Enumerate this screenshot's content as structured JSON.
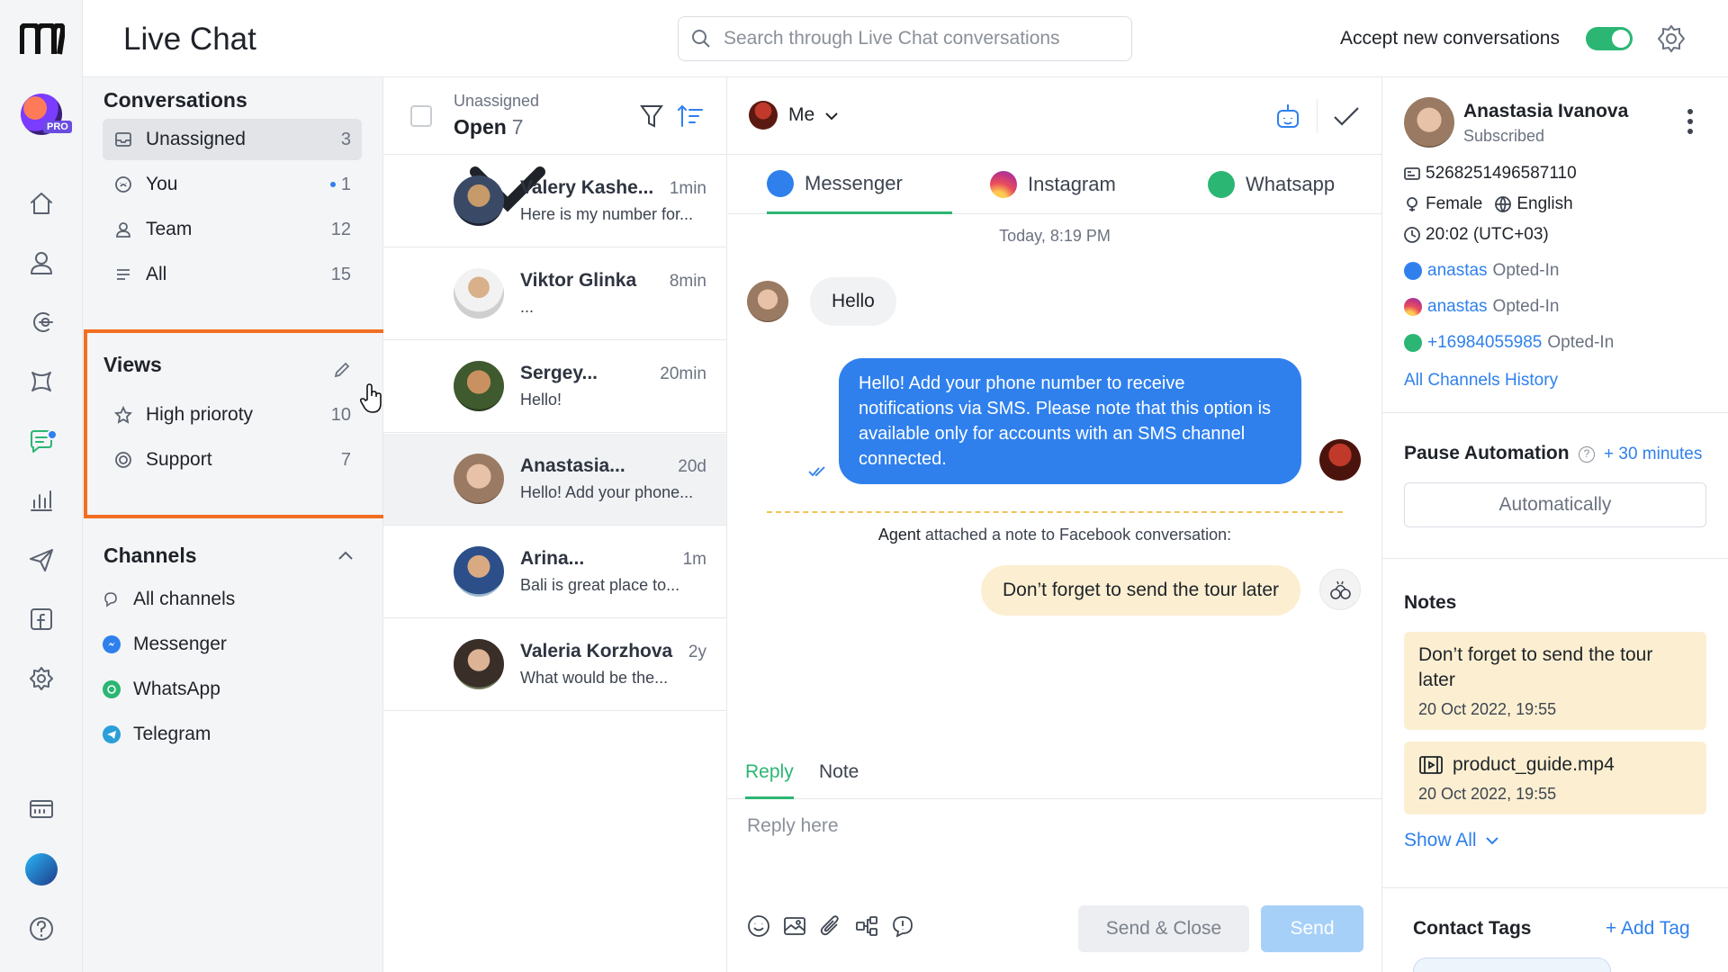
{
  "header": {
    "title": "Live Chat",
    "search_placeholder": "Search through Live Chat conversations",
    "accept_label": "Accept new conversations",
    "accept_enabled": true
  },
  "rail": {
    "badge": "PRO",
    "icons": [
      "logo-icon",
      "home-icon",
      "contacts-icon",
      "automation-icon",
      "integrations-icon",
      "live-chat-icon",
      "analytics-icon",
      "broadcast-icon",
      "facebook-page-icon",
      "settings-icon",
      "billing-icon",
      "brand-icon",
      "help-icon"
    ]
  },
  "sidebar": {
    "conversations_title": "Conversations",
    "conversations": [
      {
        "label": "Unassigned",
        "count": "3",
        "icon": "inbox-icon"
      },
      {
        "label": "You",
        "count": "1",
        "icon": "you-icon",
        "unread_dot": true
      },
      {
        "label": "Team",
        "count": "12",
        "icon": "team-icon"
      },
      {
        "label": "All",
        "count": "15",
        "icon": "list-icon"
      }
    ],
    "views_title": "Views",
    "views": [
      {
        "label": "High prioroty",
        "count": "10",
        "icon": "star-icon"
      },
      {
        "label": "Support",
        "count": "7",
        "icon": "support-icon"
      }
    ],
    "channels_title": "Channels",
    "channels": [
      {
        "label": "All channels",
        "icon": "chat-bubbles-icon"
      },
      {
        "label": "Messenger",
        "icon": "messenger-icon",
        "color": "#2f80ed"
      },
      {
        "label": "WhatsApp",
        "icon": "whatsapp-icon",
        "color": "#2bb673"
      },
      {
        "label": "Telegram",
        "icon": "telegram-icon",
        "color": "#2b9fd9"
      }
    ]
  },
  "list": {
    "filter_sub": "Unassigned",
    "filter_main": "Open",
    "filter_count": "7",
    "conversations": [
      {
        "name": "Valery Kashe...",
        "time": "1min",
        "preview": "Here is my number for..."
      },
      {
        "name": "Viktor Glinka",
        "time": "8min",
        "preview": "..."
      },
      {
        "name": "Sergey...",
        "time": "20min",
        "preview": "Hello!"
      },
      {
        "name": "Anastasia...",
        "time": "20d",
        "preview": "Hello! Add your phone..."
      },
      {
        "name": "Arina...",
        "time": "1m",
        "preview": "Bali is great place to..."
      },
      {
        "name": "Valeria Korzhova",
        "time": "2y",
        "preview": "What would be the..."
      }
    ]
  },
  "chat": {
    "assignee": "Me",
    "tabs": [
      "Messenger",
      "Instagram",
      "Whatsapp"
    ],
    "day_label": "Today, 8:19 PM",
    "incoming": "Hello",
    "outgoing": "Hello! Add your phone number to receive notifications via SMS. Please note that this option is available only for accounts with an SMS channel connected.",
    "note_author": "Agent",
    "note_caption": "attached a note to Facebook conversation:",
    "note_text": "Don’t forget to send the tour later",
    "reply_tabs": [
      "Reply",
      "Note"
    ],
    "reply_placeholder": "Reply here",
    "send_close_label": "Send & Close",
    "send_label": "Send"
  },
  "contact": {
    "name": "Anastasia Ivanova",
    "status": "Subscribed",
    "id": "5268251496587110",
    "gender": "Female",
    "language": "English",
    "time": "20:02 (UTC+03)",
    "channels": [
      {
        "handle": "anastas",
        "status": "Opted-In",
        "icon": "messenger-icon"
      },
      {
        "handle": "anastas",
        "status": "Opted-In",
        "icon": "instagram-icon"
      },
      {
        "handle": "+16984055985",
        "status": "Opted-In",
        "icon": "whatsapp-icon"
      }
    ],
    "history_link": "All Channels History",
    "pause_title": "Pause Automation",
    "pause_add": "+ 30 minutes",
    "pause_mode": "Automatically",
    "notes_title": "Notes",
    "notes": [
      {
        "text": "Don’t forget to send the tour later",
        "date": "20 Oct 2022, 19:55"
      },
      {
        "text": "product_guide.mp4",
        "date": "20 Oct 2022, 19:55"
      }
    ],
    "show_all": "Show All",
    "tags_title": "Contact Tags",
    "add_tag": "+ Add Tag"
  }
}
